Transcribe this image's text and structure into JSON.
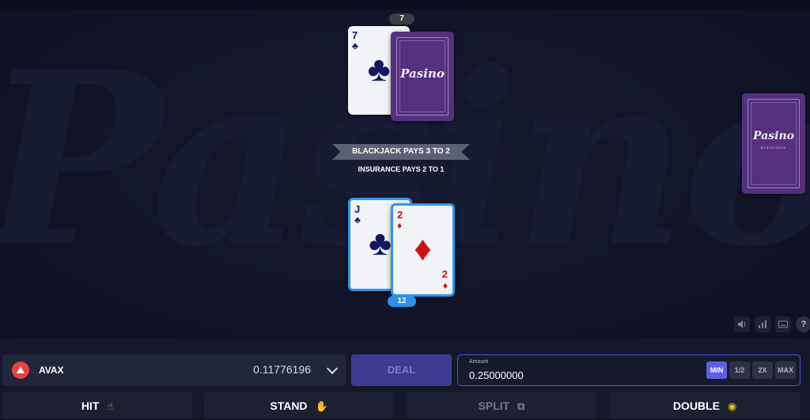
{
  "watermark": "Pasino",
  "dealer": {
    "score": "7",
    "up_card": {
      "rank": "7",
      "suit": "♣"
    },
    "hole_card_logo": "Pasino"
  },
  "shoe": {
    "logo": "Pasino",
    "sub": "BLACKJACK"
  },
  "rules": {
    "blackjack": "BLACKJACK PAYS 3 TO 2",
    "insurance": "INSURANCE PAYS 2 TO 1"
  },
  "player": {
    "score": "12",
    "cards": [
      {
        "rank": "J",
        "suit": "♣"
      },
      {
        "rank": "2",
        "suit": "♦"
      }
    ]
  },
  "utility_icons": [
    "sound-icon",
    "stats-icon",
    "keyboard-icon",
    "help-icon"
  ],
  "help_glyph": "?",
  "currency": {
    "name": "AVAX",
    "balance": "0.11776196"
  },
  "deal_label": "DEAL",
  "amount": {
    "label": "Amount",
    "value": "0.25000000",
    "buttons": [
      "MIN",
      "1/2",
      "2X",
      "MAX"
    ],
    "active": "MIN"
  },
  "actions": {
    "hit": "HIT",
    "stand": "STAND",
    "split": "SPLIT",
    "double": "DOUBLE"
  },
  "colors": {
    "accent": "#5c5fe6",
    "player_card_border": "#2a97f2",
    "card_back": "#54307e",
    "avax": "#e84142"
  }
}
